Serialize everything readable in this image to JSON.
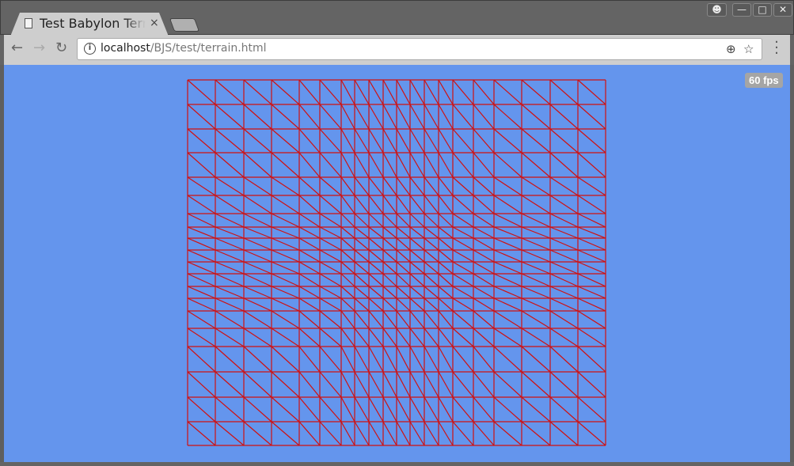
{
  "browser": {
    "tab_title": "Test Babylon Terrain",
    "tab_close": "×",
    "url_host": "localhost",
    "url_path": "/BJS/test/terrain.html",
    "info_icon": "i",
    "window_buttons": [
      "user-icon",
      "minimize-icon",
      "maximize-icon",
      "close-icon"
    ]
  },
  "scene": {
    "fps_label": "60 fps",
    "background_color": "#6495ed",
    "wireframe_color": "#d01010"
  }
}
